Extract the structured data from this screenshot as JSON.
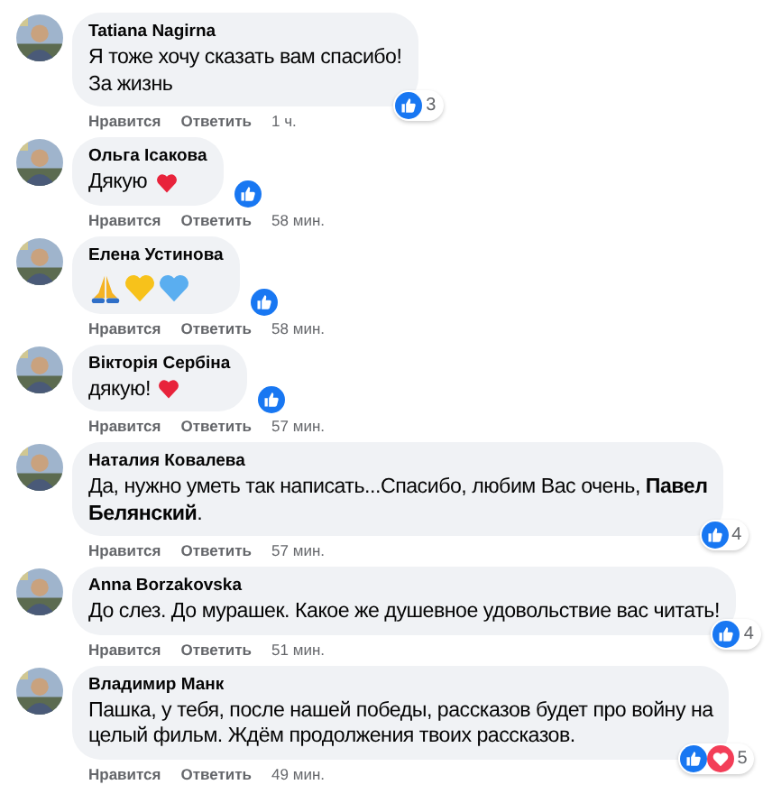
{
  "comments": [
    {
      "author": "Tatiana Nagirna",
      "lines": [
        "Я тоже хочу сказать вам спасибо!",
        "За жизнь"
      ],
      "reactions": {
        "types": [
          {
            "kind": "like"
          }
        ],
        "count": "3"
      },
      "actions": [
        "Нравится",
        "Ответить"
      ],
      "time": "1 ч."
    },
    {
      "author": "Ольга Ісакова",
      "lines": [
        "Дякую"
      ],
      "emojis": [
        {
          "kind": "red-heart"
        }
      ],
      "reactions": {
        "types": [
          {
            "kind": "like"
          }
        ]
      },
      "actions": [
        "Нравится",
        "Ответить"
      ],
      "time": "58 мин."
    },
    {
      "author": "Елена Устинова",
      "emojis": [
        {
          "kind": "pray"
        },
        {
          "kind": "yellow-heart"
        },
        {
          "kind": "blue-heart"
        }
      ],
      "jumbo": true,
      "reactions": {
        "types": [
          {
            "kind": "like"
          }
        ]
      },
      "actions": [
        "Нравится",
        "Ответить"
      ],
      "time": "58 мин."
    },
    {
      "author": "Вікторія Сербіна",
      "lines": [
        "дякую!"
      ],
      "emojis": [
        {
          "kind": "red-heart"
        }
      ],
      "reactions": {
        "types": [
          {
            "kind": "like"
          }
        ]
      },
      "actions": [
        "Нравится",
        "Ответить"
      ],
      "time": "57 мин."
    },
    {
      "author": "Наталия Ковалева",
      "lines": [
        "Да, нужно уметь так написать...Спасибо, любим Вас очень, **Павел**",
        "**Белянский**."
      ],
      "reactions": {
        "types": [
          {
            "kind": "like"
          }
        ],
        "count": "4"
      },
      "actions": [
        "Нравится",
        "Ответить"
      ],
      "time": "57 мин."
    },
    {
      "author": "Anna Borzakovska",
      "lines": [
        "До слез. До мурашек. Какое же душевное удовольствие вас читать!"
      ],
      "reactions": {
        "types": [
          {
            "kind": "like"
          }
        ],
        "count": "4"
      },
      "actions": [
        "Нравится",
        "Ответить"
      ],
      "time": "51 мин."
    },
    {
      "author": "Владимир Манк",
      "lines": [
        "Пашка, у тебя, после нашей победы, рассказов будет про войну на",
        "целый фильм. Ждём продолжения твоих рассказов."
      ],
      "reactions": {
        "types": [
          {
            "kind": "like"
          },
          {
            "kind": "love"
          }
        ],
        "count": "5"
      },
      "actions": [
        "Нравится",
        "Ответить"
      ],
      "time": "49 мин."
    }
  ]
}
